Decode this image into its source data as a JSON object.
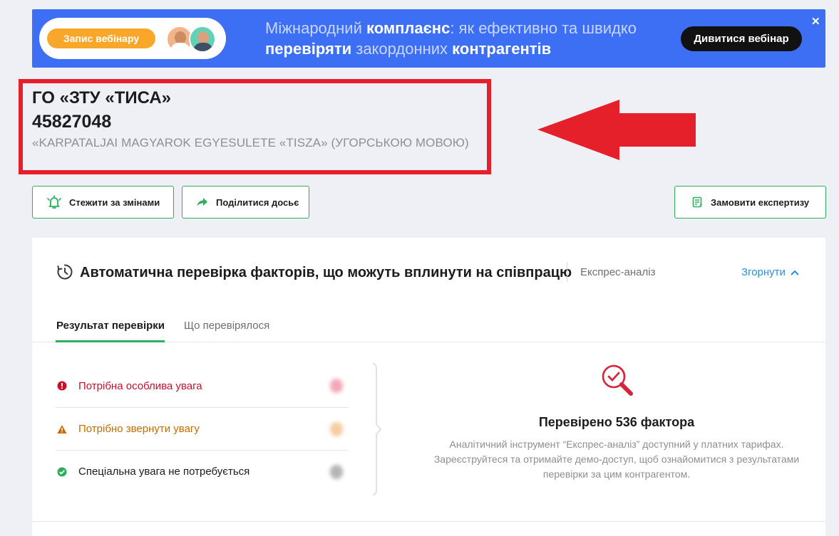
{
  "banner": {
    "badge_label": "Запис вебінару",
    "text_parts": [
      {
        "text": "Міжнародний ",
        "bold": false
      },
      {
        "text": "комплаєнс",
        "bold": true
      },
      {
        "text": ": як ефективно та швидко ",
        "bold": false
      },
      {
        "text": "перевіряти",
        "bold": true
      },
      {
        "text": " закордонних ",
        "bold": false
      },
      {
        "text": "контрагентів",
        "bold": true
      }
    ],
    "cta_label": "Дивитися вебінар",
    "close_label": "✕"
  },
  "company": {
    "name": "ГО «ЗТУ «ТИСА»",
    "code": "45827048",
    "alt_name": "«KARPATALJAI MAGYAROK EGYESULETE «TISZA» (УГОРСЬКОЮ МОВОЮ)"
  },
  "actions": {
    "follow_label": "Стежити за змінами",
    "share_label": "Поділитися досьє",
    "order_label": "Замовити експертизу"
  },
  "check_card": {
    "title": "Автоматична перевірка факторів, що можуть вплинути на співпрацю",
    "subtitle": "Експрес-аналіз",
    "collapse_label": "Згорнути",
    "tabs": [
      {
        "label": "Результат перевірки",
        "active": true
      },
      {
        "label": "Що перевірялося",
        "active": false
      }
    ],
    "results": [
      {
        "label": "Потрібна особлива увага",
        "color": "#c8102e",
        "icon": "exclamation-circle-icon"
      },
      {
        "label": "Потрібно звернути увагу",
        "color": "#c46c00",
        "icon": "warning-triangle-icon"
      },
      {
        "label": "Спеціальна увага не потребується",
        "color": "#1c1c1e",
        "icon": "check-circle-icon"
      }
    ],
    "checked_title": "Перевірено 536 фактора",
    "checked_desc": "Аналітичний інструмент “Експрес-аналіз” доступний у платних тарифах. Зареєструйтеся та отримайте демо-доступ, щоб ознайомитися з результатами перевірки за цим контрагентом."
  },
  "colors": {
    "banner_bg": "#3d6ff5",
    "accent_green": "#2bb05d",
    "highlight_red": "#e5202b",
    "link_blue": "#2a8ee0"
  }
}
